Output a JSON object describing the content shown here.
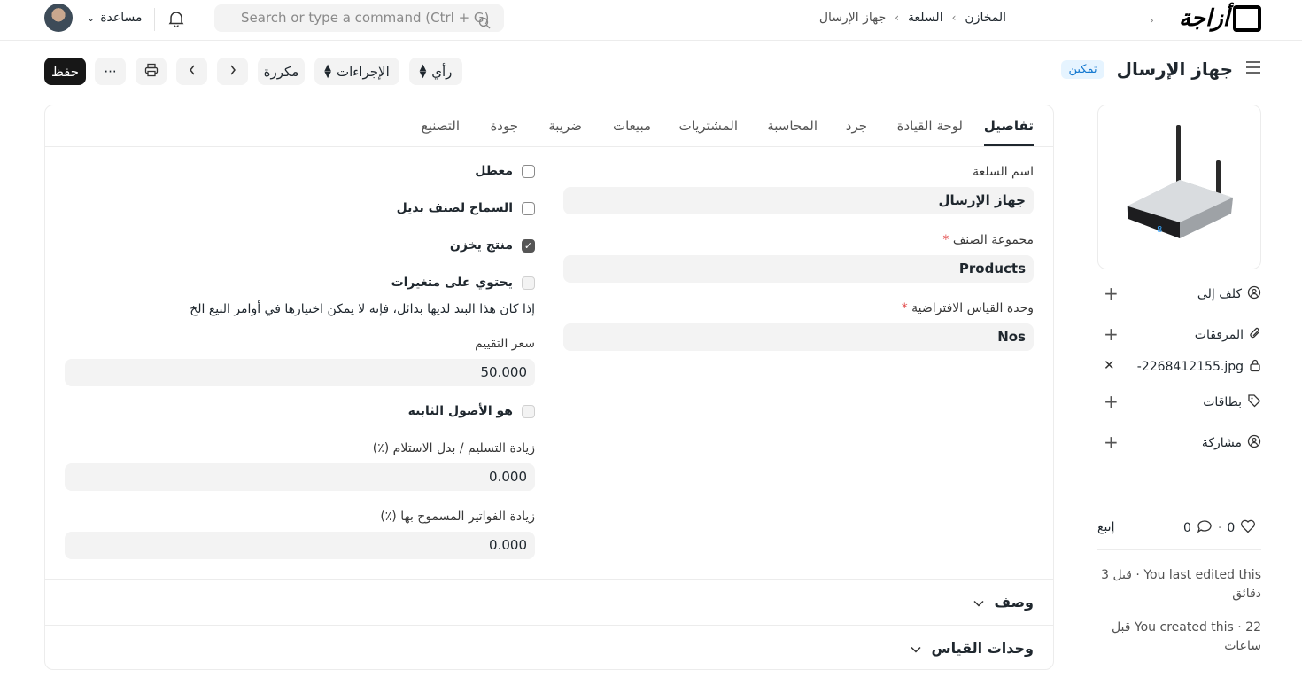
{
  "navbar": {
    "brand": "أزاجة",
    "breadcrumbs": [
      "المخازن",
      "السلعة",
      "جهاز الإرسال"
    ],
    "search_placeholder": "Search or type a command (Ctrl + G)",
    "help_label": "مساعدة"
  },
  "toolbar": {
    "save_label": "حفظ",
    "more_label": "···",
    "repeated_label": "مكررة",
    "actions_label": "الإجراءات",
    "view_label": "رأي"
  },
  "doc": {
    "title": "جهاز الإرسال",
    "status": "تمكين"
  },
  "tabs": [
    "تفاصيل",
    "لوحة القيادة",
    "جرد",
    "المحاسبة",
    "المشتريات",
    "مبيعات",
    "ضريبة",
    "جودة",
    "التصنيع"
  ],
  "form": {
    "item_name_label": "اسم السلعة",
    "item_name": "جهاز الإرسال",
    "item_group_label": "مجموعة الصنف",
    "item_group": "Products",
    "uom_label": "وحدة القياس الافتراضية",
    "uom": "Nos",
    "disabled_label": "معطل",
    "allow_alternative_label": "السماح لصنف بديل",
    "is_stock_label": "منتج يخزن",
    "has_variants_label": "يحتوي على متغيرات",
    "variants_help": "إذا كان هذا البند لديها بدائل، فإنه لا يمكن اختيارها في أوامر البيع الخ",
    "valuation_label": "سعر التقييم",
    "valuation": "50.000",
    "fixed_asset_label": "هو الأصول الثابتة",
    "over_delivery_label": "زيادة التسليم / بدل الاستلام (٪)",
    "over_delivery": "0.000",
    "over_billing_label": "زيادة الفواتير المسموح بها (٪)",
    "over_billing": "0.000",
    "required_mark": "*"
  },
  "sections": {
    "description": "وصف",
    "uoms": "وحدات القياس"
  },
  "sidebar": {
    "assigned_to": "كلف إلى",
    "attachments": "المرفقات",
    "attachment_file": "-2268412155.jpg",
    "tags": "بطاقات",
    "share": "مشاركة",
    "follow": "إتبع",
    "likes": "0",
    "comments": "0",
    "last_edited": "You last edited this · قبل 3 دقائق",
    "created": "You created this · 22 قبل ساعات"
  },
  "colors": {
    "primary": "#171717",
    "badge_bg": "#e6f4ff",
    "badge_text": "#1579d0",
    "required": "#e24c4c"
  }
}
